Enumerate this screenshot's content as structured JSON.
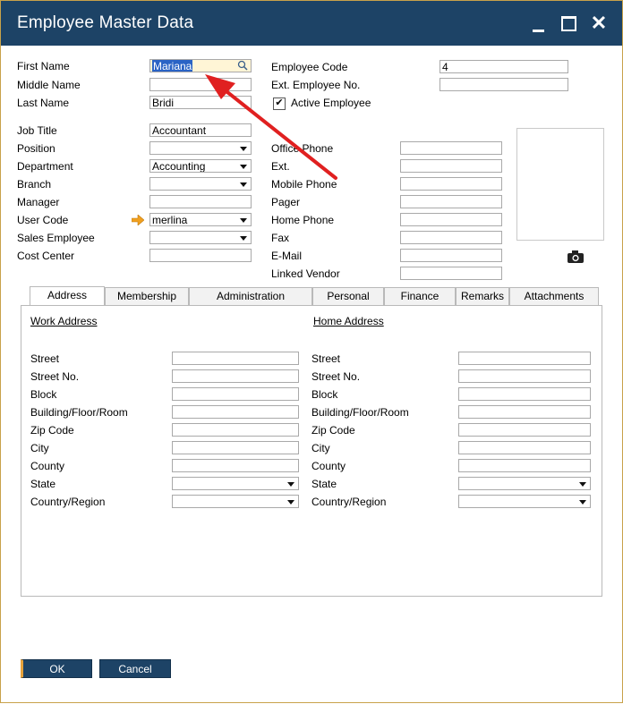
{
  "window": {
    "title": "Employee Master Data"
  },
  "header_left": {
    "first_name": {
      "label": "First Name",
      "value": "Mariana"
    },
    "middle_name": {
      "label": "Middle Name",
      "value": ""
    },
    "last_name": {
      "label": "Last Name",
      "value": "Bridi"
    }
  },
  "header_right": {
    "employee_code": {
      "label": "Employee Code",
      "value": "4"
    },
    "ext_employee_no": {
      "label": "Ext. Employee No.",
      "value": ""
    },
    "active_employee": {
      "label": "Active Employee",
      "checked": true
    }
  },
  "left_fields": [
    {
      "label": "Job Title",
      "value": "Accountant",
      "type": "text"
    },
    {
      "label": "Position",
      "value": "",
      "type": "select"
    },
    {
      "label": "Department",
      "value": "Accounting",
      "type": "select"
    },
    {
      "label": "Branch",
      "value": "",
      "type": "select"
    },
    {
      "label": "Manager",
      "value": "",
      "type": "text"
    },
    {
      "label": "User Code",
      "value": "merlina",
      "type": "select"
    },
    {
      "label": "Sales Employee",
      "value": "",
      "type": "select"
    },
    {
      "label": "Cost Center",
      "value": "",
      "type": "text"
    }
  ],
  "right_fields": [
    {
      "label": "Office Phone",
      "value": ""
    },
    {
      "label": "Ext.",
      "value": ""
    },
    {
      "label": "Mobile Phone",
      "value": ""
    },
    {
      "label": "Pager",
      "value": ""
    },
    {
      "label": "Home Phone",
      "value": ""
    },
    {
      "label": "Fax",
      "value": ""
    },
    {
      "label": "E-Mail",
      "value": ""
    },
    {
      "label": "Linked Vendor",
      "value": ""
    }
  ],
  "tabs": [
    {
      "label": "Address",
      "active": true
    },
    {
      "label": "Membership",
      "active": false
    },
    {
      "label": "Administration",
      "active": false
    },
    {
      "label": "Personal",
      "active": false
    },
    {
      "label": "Finance",
      "active": false
    },
    {
      "label": "Remarks",
      "active": false
    },
    {
      "label": "Attachments",
      "active": false
    }
  ],
  "work_address": {
    "title": "Work Address",
    "fields": [
      {
        "label": "Street",
        "value": "",
        "type": "text"
      },
      {
        "label": "Street No.",
        "value": "",
        "type": "text"
      },
      {
        "label": "Block",
        "value": "",
        "type": "text"
      },
      {
        "label": "Building/Floor/Room",
        "value": "",
        "type": "text"
      },
      {
        "label": "Zip Code",
        "value": "",
        "type": "text"
      },
      {
        "label": "City",
        "value": "",
        "type": "text"
      },
      {
        "label": "County",
        "value": "",
        "type": "text"
      },
      {
        "label": "State",
        "value": "",
        "type": "select"
      },
      {
        "label": "Country/Region",
        "value": "",
        "type": "select"
      }
    ]
  },
  "home_address": {
    "title": "Home Address",
    "fields": [
      {
        "label": "Street",
        "value": "",
        "type": "text"
      },
      {
        "label": "Street No.",
        "value": "",
        "type": "text"
      },
      {
        "label": "Block",
        "value": "",
        "type": "text"
      },
      {
        "label": "Building/Floor/Room",
        "value": "",
        "type": "text"
      },
      {
        "label": "Zip Code",
        "value": "",
        "type": "text"
      },
      {
        "label": "City",
        "value": "",
        "type": "text"
      },
      {
        "label": "County",
        "value": "",
        "type": "text"
      },
      {
        "label": "State",
        "value": "",
        "type": "select"
      },
      {
        "label": "Country/Region",
        "value": "",
        "type": "select"
      }
    ]
  },
  "buttons": {
    "ok": "OK",
    "cancel": "Cancel"
  },
  "icons": {
    "minimize": "minimize-icon",
    "maximize": "maximize-icon",
    "close": "close-icon",
    "camera": "camera-icon",
    "link_arrow": "link-arrow-icon",
    "search": "search-icon"
  },
  "colors": {
    "titlebar": "#1d4366",
    "button": "#1d4366",
    "selection": "#2a63c5",
    "annotation_arrow": "#e02020",
    "link_arrow": "#f0a020"
  }
}
